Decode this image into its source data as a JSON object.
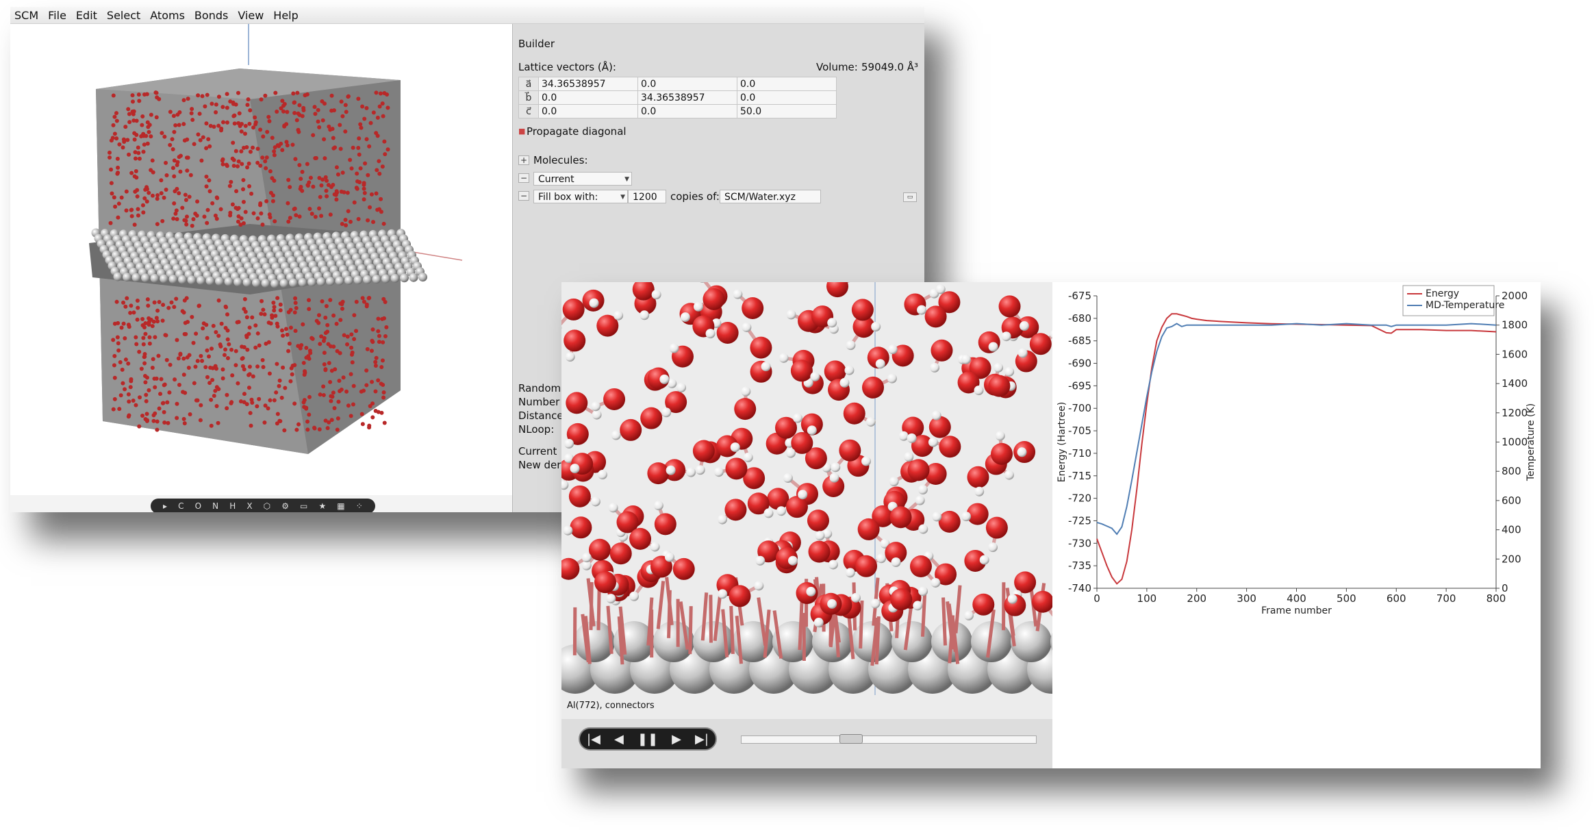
{
  "menubar": {
    "items": [
      "SCM",
      "File",
      "Edit",
      "Select",
      "Atoms",
      "Bonds",
      "View",
      "Help"
    ]
  },
  "builder": {
    "title": "Builder",
    "lattice_label": "Lattice vectors (Å):",
    "volume_label": "Volume:",
    "volume_value": "59049.0 Å³",
    "vectors": [
      {
        "name": "a⃗",
        "x": "34.36538957",
        "y": "0.0",
        "z": "0.0"
      },
      {
        "name": "b⃗",
        "x": "0.0",
        "y": "34.36538957",
        "z": "0.0"
      },
      {
        "name": "c⃗",
        "x": "0.0",
        "y": "0.0",
        "z": "50.0"
      }
    ],
    "propagate_label": "Propagate diagonal",
    "molecules_label": "Molecules:",
    "current_option": "Current",
    "fill_box_label": "Fill box with:",
    "copies_value": "1200",
    "copies_label": "copies of:",
    "file_value": "SCM/Water.xyz",
    "partial_labels": [
      "Random",
      "Number",
      "Distance",
      "NLoop:",
      "Current",
      "New der"
    ]
  },
  "toolbar3d": {
    "items": [
      "▸",
      "C",
      "O",
      "N",
      "H",
      "X",
      "⬡",
      "⚙",
      "▭",
      "★",
      "▦",
      "⁘"
    ]
  },
  "moleculeview": {
    "status": "Al(772),  connectors"
  },
  "player": {
    "buttons": [
      "|◀",
      "◀",
      "❚❚",
      "▶",
      "▶|"
    ],
    "position_fraction": 0.36
  },
  "chart_data": {
    "type": "line",
    "xlabel": "Frame number",
    "ylabel_left": "Energy (Hartree)",
    "ylabel_right": "Temperature (K)",
    "xlim": [
      0,
      800
    ],
    "ylim_left": [
      -740,
      -675
    ],
    "ylim_right": [
      0,
      2000
    ],
    "x_ticks": [
      "0",
      "100",
      "200",
      "300",
      "400",
      "500",
      "600",
      "700",
      "800"
    ],
    "y_left_ticks": [
      "-675",
      "-680",
      "-685",
      "-690",
      "-695",
      "-700",
      "-705",
      "-710",
      "-715",
      "-720",
      "-725",
      "-730",
      "-735",
      "-740"
    ],
    "y_right_ticks": [
      "2000",
      "1800",
      "1600",
      "1400",
      "1200",
      "1000",
      "800",
      "600",
      "400",
      "200",
      "0"
    ],
    "legend_position": "top-right",
    "series": [
      {
        "name": "Energy",
        "axis": "left",
        "color": "#c8373b",
        "x": [
          0,
          10,
          20,
          30,
          40,
          50,
          60,
          70,
          80,
          90,
          100,
          110,
          120,
          130,
          140,
          150,
          160,
          170,
          180,
          190,
          200,
          220,
          250,
          300,
          350,
          400,
          450,
          500,
          550,
          580,
          590,
          600,
          650,
          700,
          750,
          800
        ],
        "y": [
          -729,
          -732,
          -735,
          -737.5,
          -739,
          -738,
          -734,
          -727,
          -718,
          -708,
          -699,
          -691,
          -685,
          -682,
          -680,
          -679,
          -679,
          -679.3,
          -679.6,
          -680,
          -680.2,
          -680.5,
          -680.7,
          -681,
          -681.2,
          -681.3,
          -681.4,
          -681.5,
          -681.6,
          -683.2,
          -683.3,
          -682.5,
          -682.5,
          -682.7,
          -682.7,
          -683
        ]
      },
      {
        "name": "MD-Temperature",
        "axis": "right",
        "color": "#4f7db3",
        "x": [
          0,
          10,
          20,
          30,
          40,
          50,
          60,
          70,
          80,
          90,
          100,
          110,
          120,
          130,
          140,
          150,
          160,
          170,
          180,
          200,
          250,
          300,
          350,
          400,
          450,
          500,
          550,
          580,
          590,
          600,
          650,
          700,
          750,
          800
        ],
        "y": [
          450,
          440,
          425,
          410,
          370,
          420,
          560,
          740,
          930,
          1120,
          1310,
          1480,
          1620,
          1720,
          1780,
          1790,
          1810,
          1790,
          1800,
          1800,
          1800,
          1800,
          1800,
          1810,
          1800,
          1810,
          1800,
          1800,
          1790,
          1800,
          1800,
          1800,
          1810,
          1800
        ]
      }
    ]
  }
}
